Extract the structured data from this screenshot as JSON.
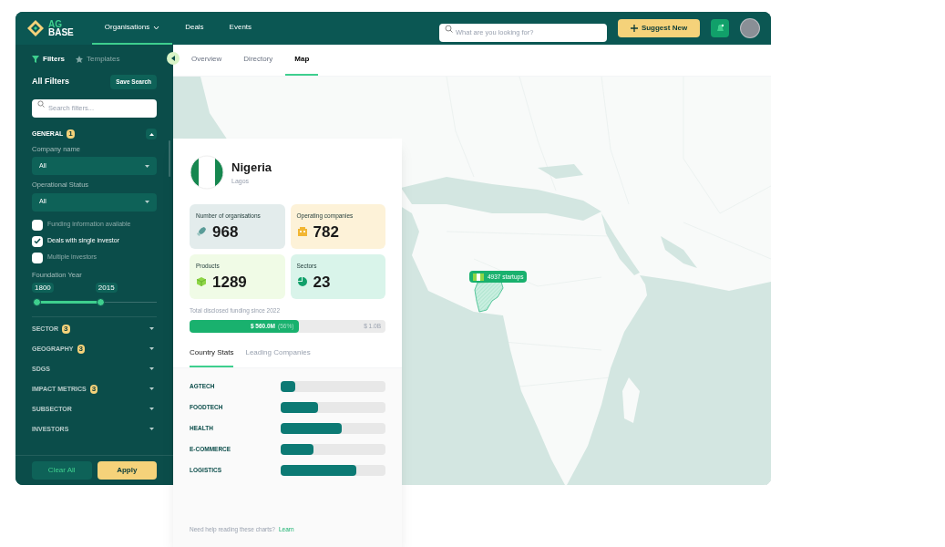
{
  "header": {
    "logo": [
      "AG",
      "BASE"
    ],
    "nav": [
      {
        "label": "Organisations",
        "selected": true,
        "dropdown": true
      },
      {
        "label": "Deals",
        "selected": false,
        "dropdown": false
      },
      {
        "label": "Events",
        "selected": false,
        "dropdown": false
      }
    ],
    "search": {
      "placeholder": "What are you looking for?"
    },
    "suggest_button": "Suggest New"
  },
  "sidebar": {
    "tabs": [
      {
        "label": "Filters",
        "selected": true,
        "kind": "filter"
      },
      {
        "label": "Templates",
        "selected": false,
        "kind": "star"
      }
    ],
    "title": "All Filters",
    "save_button": "Save Search",
    "search": {
      "placeholder": "Search filters..."
    },
    "general": {
      "label": "GENERAL",
      "badge": "1",
      "expanded": true,
      "fields": [
        {
          "label": "Company name",
          "value": "All"
        },
        {
          "label": "Operational Status",
          "value": "All"
        }
      ],
      "checkboxes": [
        {
          "label": "Funding information available",
          "checked": false
        },
        {
          "label": "Deals with single investor",
          "checked": true
        },
        {
          "label": "Multiple investors",
          "checked": false
        }
      ],
      "slider": {
        "label": "Foundation Year",
        "min_label": "1800",
        "max_label": "2015",
        "level": 0.55
      }
    },
    "sections": [
      {
        "label": "SECTOR",
        "badge": "3",
        "expanded": false
      },
      {
        "label": "GEOGRAPHY",
        "badge": "3",
        "expanded": false
      },
      {
        "label": "SDGS",
        "expanded": false
      },
      {
        "label": "IMPACT METRICS",
        "badge": "3",
        "expanded": false
      },
      {
        "label": "SUBSECTOR",
        "expanded": false
      },
      {
        "label": "INVESTORS",
        "expanded": false
      }
    ],
    "clear_button": "Clear All",
    "apply_button": "Apply"
  },
  "content_tabs": [
    {
      "label": "Overview",
      "selected": false
    },
    {
      "label": "Directory",
      "selected": false
    },
    {
      "label": "Map",
      "selected": true
    }
  ],
  "map": {
    "tooltip": "4937 startups"
  },
  "country_card": {
    "name": "Nigeria",
    "city": "Lagos",
    "stats": [
      {
        "label": "Number of organisations",
        "value": "968",
        "kind": "rocket",
        "color": "#e3ecec"
      },
      {
        "label": "Operating companies",
        "value": "782",
        "kind": "building",
        "color": "#fdf2d8"
      },
      {
        "label": "Products",
        "value": "1289",
        "kind": "cube",
        "color": "#f0fbe6"
      },
      {
        "label": "Sectors",
        "value": "23",
        "kind": "pie",
        "color": "#d9f4ea"
      }
    ],
    "funding": {
      "label": "Total disclosed funding since 2022",
      "amount": "$ 560.0M",
      "share": "(56%)",
      "total": "$ 1.0B",
      "level": 0.56
    },
    "tabs": [
      {
        "label": "Country Stats",
        "selected": true
      },
      {
        "label": "Leading Companies",
        "selected": false
      }
    ],
    "sectors": [
      {
        "label": "AGTECH",
        "level": 0.14
      },
      {
        "label": "FOODTECH",
        "level": 0.36
      },
      {
        "label": "HEALTH",
        "level": 0.58
      },
      {
        "label": "E-COMMERCE",
        "level": 0.31
      },
      {
        "label": "LOGISTICS",
        "level": 0.72
      }
    ],
    "help": {
      "text": "Need help reading these charts?",
      "link": "Learn"
    }
  }
}
